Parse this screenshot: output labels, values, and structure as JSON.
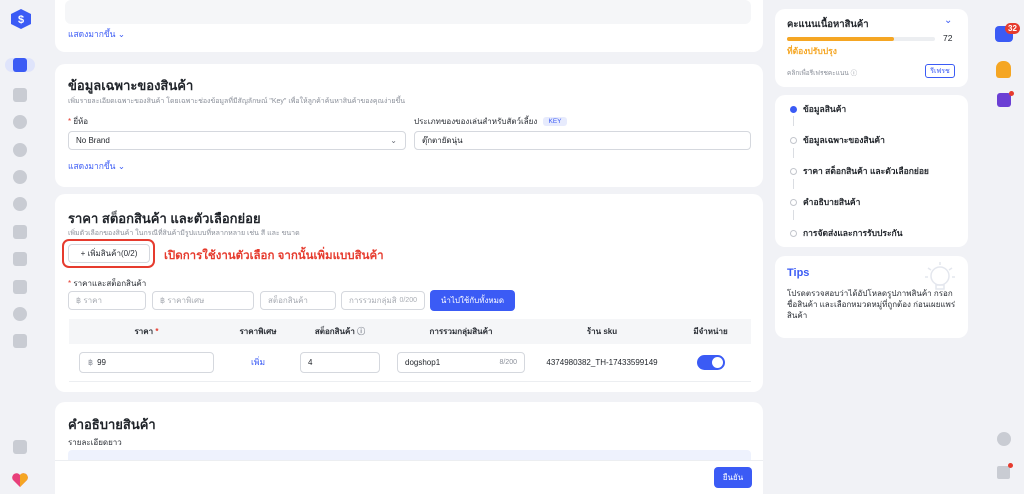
{
  "top_card": {
    "show_more": "แสดงมากขึ้น"
  },
  "specs": {
    "title": "ข้อมูลเฉพาะของสินค้า",
    "subtitle": "เพิ่มรายละเอียดเฉพาะของสินค้า โดยเฉพาะช่องข้อมูลที่มีสัญลักษณ์ \"Key\" เพื่อให้ลูกค้าค้นหาสินค้าของคุณง่ายขึ้น",
    "brand_label": "ยี่ห้อ",
    "brand_value": "No Brand",
    "pet_label": "ประเภทของของเล่นสำหรับสัตว์เลี้ยง",
    "key_tag": "KEY",
    "pet_value": "ตุ๊กตายัดนุ่น",
    "show_more": "แสดงมากขึ้น"
  },
  "pricing": {
    "title": "ราคา สต็อกสินค้า และตัวเลือกย่อย",
    "subtitle": "เพิ่มตัวเลือกของสินค้า ในกรณีที่สินค้ามีรูปแบบที่หลากหลาย เช่น สี และ ขนาด",
    "add_variant": "+ เพิ่มสินค้า(0/2)",
    "annotation": "เปิดการใช้งานตัวเลือก จากนั้นเพิ่มแบบสินค้า",
    "price_stock_label": "ราคาและสต็อกสินค้า",
    "price_ph": "฿  ราคา",
    "special_ph": "฿  ราคาพิเศษ",
    "stock_ph": "สต็อกสินค้า",
    "group_ph": "การรวมกลุ่มสิ",
    "group_count": "0/200",
    "apply_all": "นำไปใช้กับทั้งหมด",
    "columns": [
      "ราคา",
      "ราคาพิเศษ",
      "สต็อกสินค้า",
      "การรวมกลุ่มสินค้า",
      "ร้าน sku",
      "มีจำหน่าย"
    ],
    "row": {
      "currency": "฿",
      "price": "99",
      "special": "เพิ่ม",
      "stock": "4",
      "group": "dogshop1",
      "group_count": "8/200",
      "sku": "4374980382_TH-17433599149"
    }
  },
  "description": {
    "title": "คำอธิบายสินค้า",
    "long_label": "รายละเอียดยาว"
  },
  "submit": "ยืนยัน",
  "score": {
    "title": "คะแนนเนื้อหาสินค้า",
    "value": "72",
    "progress": 0.72,
    "status": "ที่ต้องปรับปรุง",
    "refresh_hint": "คลิกเพื่อรีเฟรชคะแนน",
    "refresh": "รีเฟรช"
  },
  "steps": [
    "ข้อมูลสินค้า",
    "ข้อมูลเฉพาะของสินค้า",
    "ราคา สต็อกสินค้า และตัวเลือกย่อย",
    "คำอธิบายสินค้า",
    "การจัดส่งและการรับประกัน"
  ],
  "tips": {
    "title": "Tips",
    "body": "โปรดตรวจสอบว่าได้อัปโหลดรูปภาพสินค้า กรอกชื่อสินค้า และเลือกหมวดหมู่ที่ถูกต้อง ก่อนเผยแพร่สินค้า"
  },
  "notifications": {
    "chat_count": "32"
  },
  "colors": {
    "accent": "#3b5bf5",
    "warning": "#f5a623",
    "danger": "#e63b2e"
  }
}
